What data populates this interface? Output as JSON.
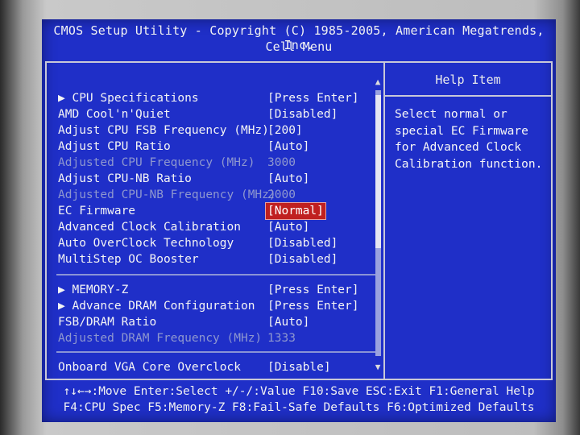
{
  "header": {
    "title": "CMOS Setup Utility - Copyright (C) 1985-2005, American Megatrends, Inc.",
    "menu": "Cell Menu"
  },
  "help": {
    "title": "Help Item",
    "text": "Select normal or special EC Firmware for Advanced Clock Calibration function."
  },
  "settings": [
    {
      "label": "▶ CPU Specifications",
      "value": "[Press Enter]",
      "dim": false
    },
    {
      "label": "AMD Cool'n'Quiet",
      "value": "[Disabled]",
      "dim": false
    },
    {
      "label": "Adjust CPU FSB Frequency (MHz)",
      "value": "[200]",
      "dim": false
    },
    {
      "label": "Adjust CPU Ratio",
      "value": "[Auto]",
      "dim": false
    },
    {
      "label": "Adjusted CPU Frequency (MHz)",
      "value": "3000",
      "dim": true
    },
    {
      "label": "Adjust CPU-NB Ratio",
      "value": "[Auto]",
      "dim": false
    },
    {
      "label": "Adjusted CPU-NB Frequency (MHz)",
      "value": "2000",
      "dim": true
    },
    {
      "label": "EC Firmware",
      "value": "[Normal]",
      "dim": false,
      "selected": true
    },
    {
      "label": "Advanced Clock Calibration",
      "value": "[Auto]",
      "dim": false
    },
    {
      "label": "Auto OverClock Technology",
      "value": "[Disabled]",
      "dim": false
    },
    {
      "label": "MultiStep OC Booster",
      "value": "[Disabled]",
      "dim": false
    },
    {
      "label": "▶ MEMORY-Z",
      "value": "[Press Enter]",
      "dim": false
    },
    {
      "label": "▶ Advance DRAM Configuration",
      "value": "[Press Enter]",
      "dim": false
    },
    {
      "label": "FSB/DRAM Ratio",
      "value": "[Auto]",
      "dim": false
    },
    {
      "label": "Adjusted DRAM Frequency (MHz)",
      "value": "1333",
      "dim": true
    },
    {
      "label": "Onboard VGA Core Overclock",
      "value": "[Disable]",
      "dim": false
    }
  ],
  "scroll": {
    "up": "▲",
    "down": "▼"
  },
  "footer": {
    "line1": "↑↓←→:Move  Enter:Select  +/-/:Value  F10:Save  ESC:Exit  F1:General Help",
    "line2": "F4:CPU Spec  F5:Memory-Z  F8:Fail-Safe Defaults  F6:Optimized Defaults"
  }
}
